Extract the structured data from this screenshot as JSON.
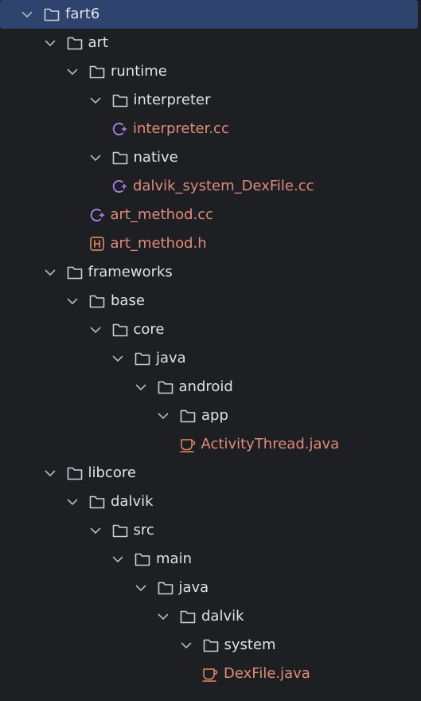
{
  "project_tree": {
    "nodes": [
      {
        "id": "fart6",
        "label": "fart6",
        "kind": "folder",
        "expanded": true,
        "depth": 0,
        "selected": true
      },
      {
        "id": "art",
        "label": "art",
        "kind": "folder",
        "expanded": true,
        "depth": 1
      },
      {
        "id": "runtime",
        "label": "runtime",
        "kind": "folder",
        "expanded": true,
        "depth": 2
      },
      {
        "id": "interpreter",
        "label": "interpreter",
        "kind": "folder",
        "expanded": true,
        "depth": 3
      },
      {
        "id": "interpreter-cc",
        "label": "interpreter.cc",
        "kind": "cpp",
        "depth": 4
      },
      {
        "id": "native",
        "label": "native",
        "kind": "folder",
        "expanded": true,
        "depth": 3
      },
      {
        "id": "dalvik-system-dexfile-cc",
        "label": "dalvik_system_DexFile.cc",
        "kind": "cpp",
        "depth": 4
      },
      {
        "id": "art-method-cc",
        "label": "art_method.cc",
        "kind": "cpp",
        "depth": 3
      },
      {
        "id": "art-method-h",
        "label": "art_method.h",
        "kind": "header",
        "depth": 3
      },
      {
        "id": "frameworks",
        "label": "frameworks",
        "kind": "folder",
        "expanded": true,
        "depth": 1
      },
      {
        "id": "base",
        "label": "base",
        "kind": "folder",
        "expanded": true,
        "depth": 2
      },
      {
        "id": "core",
        "label": "core",
        "kind": "folder",
        "expanded": true,
        "depth": 3
      },
      {
        "id": "java-1",
        "label": "java",
        "kind": "folder",
        "expanded": true,
        "depth": 4
      },
      {
        "id": "android",
        "label": "android",
        "kind": "folder",
        "expanded": true,
        "depth": 5
      },
      {
        "id": "app",
        "label": "app",
        "kind": "folder",
        "expanded": true,
        "depth": 6
      },
      {
        "id": "activitythread-java",
        "label": "ActivityThread.java",
        "kind": "java",
        "depth": 7
      },
      {
        "id": "libcore",
        "label": "libcore",
        "kind": "folder",
        "expanded": true,
        "depth": 1
      },
      {
        "id": "dalvik-1",
        "label": "dalvik",
        "kind": "folder",
        "expanded": true,
        "depth": 2
      },
      {
        "id": "src",
        "label": "src",
        "kind": "folder",
        "expanded": true,
        "depth": 3
      },
      {
        "id": "main",
        "label": "main",
        "kind": "folder",
        "expanded": true,
        "depth": 4
      },
      {
        "id": "java-2",
        "label": "java",
        "kind": "folder",
        "expanded": true,
        "depth": 5
      },
      {
        "id": "dalvik-2",
        "label": "dalvik",
        "kind": "folder",
        "expanded": true,
        "depth": 6
      },
      {
        "id": "system",
        "label": "system",
        "kind": "folder",
        "expanded": true,
        "depth": 7
      },
      {
        "id": "dexfile-java",
        "label": "DexFile.java",
        "kind": "java",
        "depth": 8
      }
    ]
  },
  "colors": {
    "background": "#1e1f22",
    "selection": "#2e436e",
    "text": "#dfe1e5",
    "file_text": "#e08b7a",
    "folder_icon": "#ced0d6",
    "chevron": "#b4b8bf",
    "cpp_icon": "#b189f5",
    "header_icon": "#e5926f",
    "java_icon": "#e9875f"
  }
}
